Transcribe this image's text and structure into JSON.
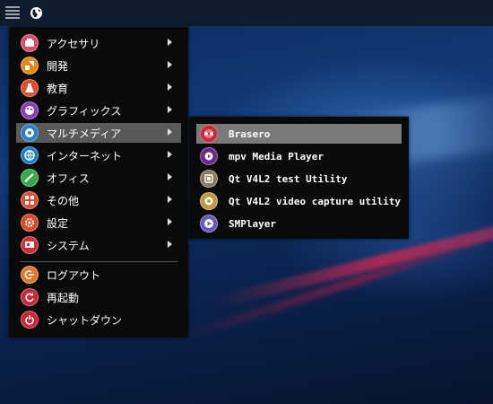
{
  "panel": {
    "icons": [
      "menu-icon",
      "globe-icon"
    ]
  },
  "main_menu": {
    "items": [
      {
        "label": "アクセサリ",
        "icon": "accessories-icon",
        "color": "#d4506a",
        "has_submenu": true
      },
      {
        "label": "開発",
        "icon": "development-icon",
        "color": "#e08a1e",
        "has_submenu": true
      },
      {
        "label": "教育",
        "icon": "education-icon",
        "color": "#d8502a",
        "has_submenu": true
      },
      {
        "label": "グラフィックス",
        "icon": "graphics-icon",
        "color": "#8a3fb8",
        "has_submenu": true
      },
      {
        "label": "マルチメディア",
        "icon": "multimedia-icon",
        "color": "#2f7fc4",
        "has_submenu": true,
        "highlighted": true
      },
      {
        "label": "インターネット",
        "icon": "internet-icon",
        "color": "#1f7cc8",
        "has_submenu": true
      },
      {
        "label": "オフィス",
        "icon": "office-icon",
        "color": "#3aa84a",
        "has_submenu": true
      },
      {
        "label": "その他",
        "icon": "other-icon",
        "color": "#d8503a",
        "has_submenu": true
      },
      {
        "label": "設定",
        "icon": "settings-icon",
        "color": "#d84a28",
        "has_submenu": true
      },
      {
        "label": "システム",
        "icon": "system-icon",
        "color": "#c8303a",
        "has_submenu": true
      }
    ],
    "actions": [
      {
        "label": "ログアウト",
        "icon": "logout-icon",
        "color": "#e07828"
      },
      {
        "label": "再起動",
        "icon": "reboot-icon",
        "color": "#c8283a"
      },
      {
        "label": "シャットダウン",
        "icon": "shutdown-icon",
        "color": "#c8283a"
      }
    ]
  },
  "sub_menu": {
    "items": [
      {
        "label": "Brasero",
        "icon": "brasero-icon",
        "color": "#c8283a",
        "highlighted": true
      },
      {
        "label": "mpv Media Player",
        "icon": "mpv-icon",
        "color": "#6a2a8a"
      },
      {
        "label": "Qt V4L2 test Utility",
        "icon": "qv4l2-icon",
        "color": "#8a7a60"
      },
      {
        "label": "Qt V4L2 video capture utility",
        "icon": "qvidcap-icon",
        "color": "#c09a40"
      },
      {
        "label": "SMPlayer",
        "icon": "smplayer-icon",
        "color": "#6a5ab8"
      }
    ]
  }
}
